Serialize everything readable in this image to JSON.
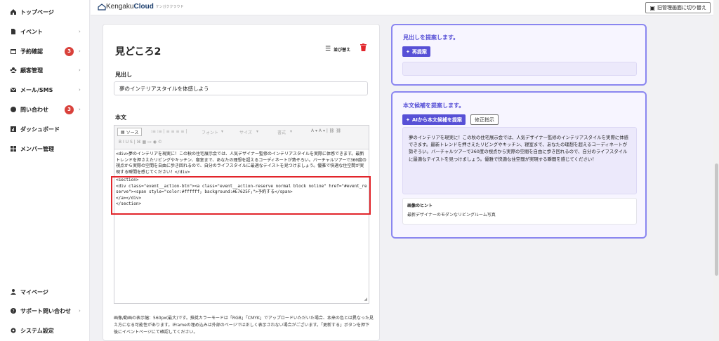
{
  "sidebar": {
    "items": [
      {
        "label": "トップページ",
        "icon": "home-icon"
      },
      {
        "label": "イベント",
        "icon": "document-icon"
      },
      {
        "label": "予約確認",
        "icon": "calendar-icon",
        "badge": "3"
      },
      {
        "label": "顧客管理",
        "icon": "users-icon"
      },
      {
        "label": "メール/SMS",
        "icon": "mail-icon"
      },
      {
        "label": "問い合わせ",
        "icon": "chat-icon",
        "badge": "3"
      },
      {
        "label": "ダッシュボード",
        "icon": "chart-icon"
      },
      {
        "label": "メンバー管理",
        "icon": "grid-icon"
      }
    ],
    "bottom_items": [
      {
        "label": "マイページ",
        "icon": "user-icon"
      },
      {
        "label": "サポート問い合わせ",
        "icon": "help-icon"
      },
      {
        "label": "システム設定",
        "icon": "gear-icon"
      }
    ]
  },
  "topbar": {
    "logo_prefix": "Kengaku",
    "logo_suffix": "Cloud",
    "logo_sub": "ケンガククラウド",
    "switch_label": "旧管理画面に切り替え"
  },
  "section": {
    "title": "見どころ2",
    "sort_label": "並び替え",
    "heading_label": "見出し",
    "heading_value": "夢のインテリアスタイルを体感しよう",
    "body_label": "本文",
    "toolbar_source": "ソース",
    "toolbar_font": "フォント",
    "toolbar_size": "サイズ",
    "toolbar_format": "書式",
    "body_text": "<div>夢のインテリアを現実に！この秋の住宅展示会では、人気デザイナー監修のインテリアスタイルを実際に体感できます。最新トレンドを押さえたリビングやキッチン、寝室まで、あなたの理想を超えるコーディネートが勢ぞろい。バーチャルツアーで360度の視点から実際の空間を自由に歩き回れるので、自分のライフスタイルに最適なテイストを見つけましょう。優雅で快適な住空間が実現する瞬間を感じてください！</div>",
    "code_text": "<section>\n<div class=\"event__action-btn\"><a class=\"event__action-reserve normal block noline\" href=\"#event_reserve\"><span style=\"color:#ffffff; background:#E7625F;\">予約する</span>\n</a></div>\n</section>",
    "note": "画像/動画の表示幅：560px(最大)です。推奨カラーモードは「RGB」「CMYK」でアップロードいただいた場合、本来の色とは異なった見え方になる可能性があります。iFrameの埋め込みは外部のページでは正しく表示されない場合がございます。「更新する」ボタンを押下後にイベントページにて確認してください。"
  },
  "heading_panel": {
    "title": "見出しを提案します。",
    "regen_label": "再提案"
  },
  "body_panel": {
    "title": "本文候補を提案します。",
    "ai_label": "AIから本文候補を提案",
    "edit_label": "修正指示",
    "suggestion": "夢のインテリアを現実に！この秋の住宅展示会では、人気デザイナー監修のインテリアスタイルを実際に体感できます。最新トレンドを押さえたリビングやキッチン、寝室まで、あなたの理想を超えるコーディネートが勢ぞろい。バーチャルツアーで360度の視点から実際の空間を自由に歩き回れるので、自分のライフスタイルに最適なテイストを見つけましょう。優雅で快適な住空間が実現する瞬間を感じてください！",
    "hint_title": "画像のヒント",
    "hint_text": "最新デザイナーのモダンなリビングルーム写真"
  },
  "colors": {
    "accent": "#5750d6",
    "badge": "#d9413b",
    "highlight": "#e2252b",
    "danger": "#e2252b"
  }
}
